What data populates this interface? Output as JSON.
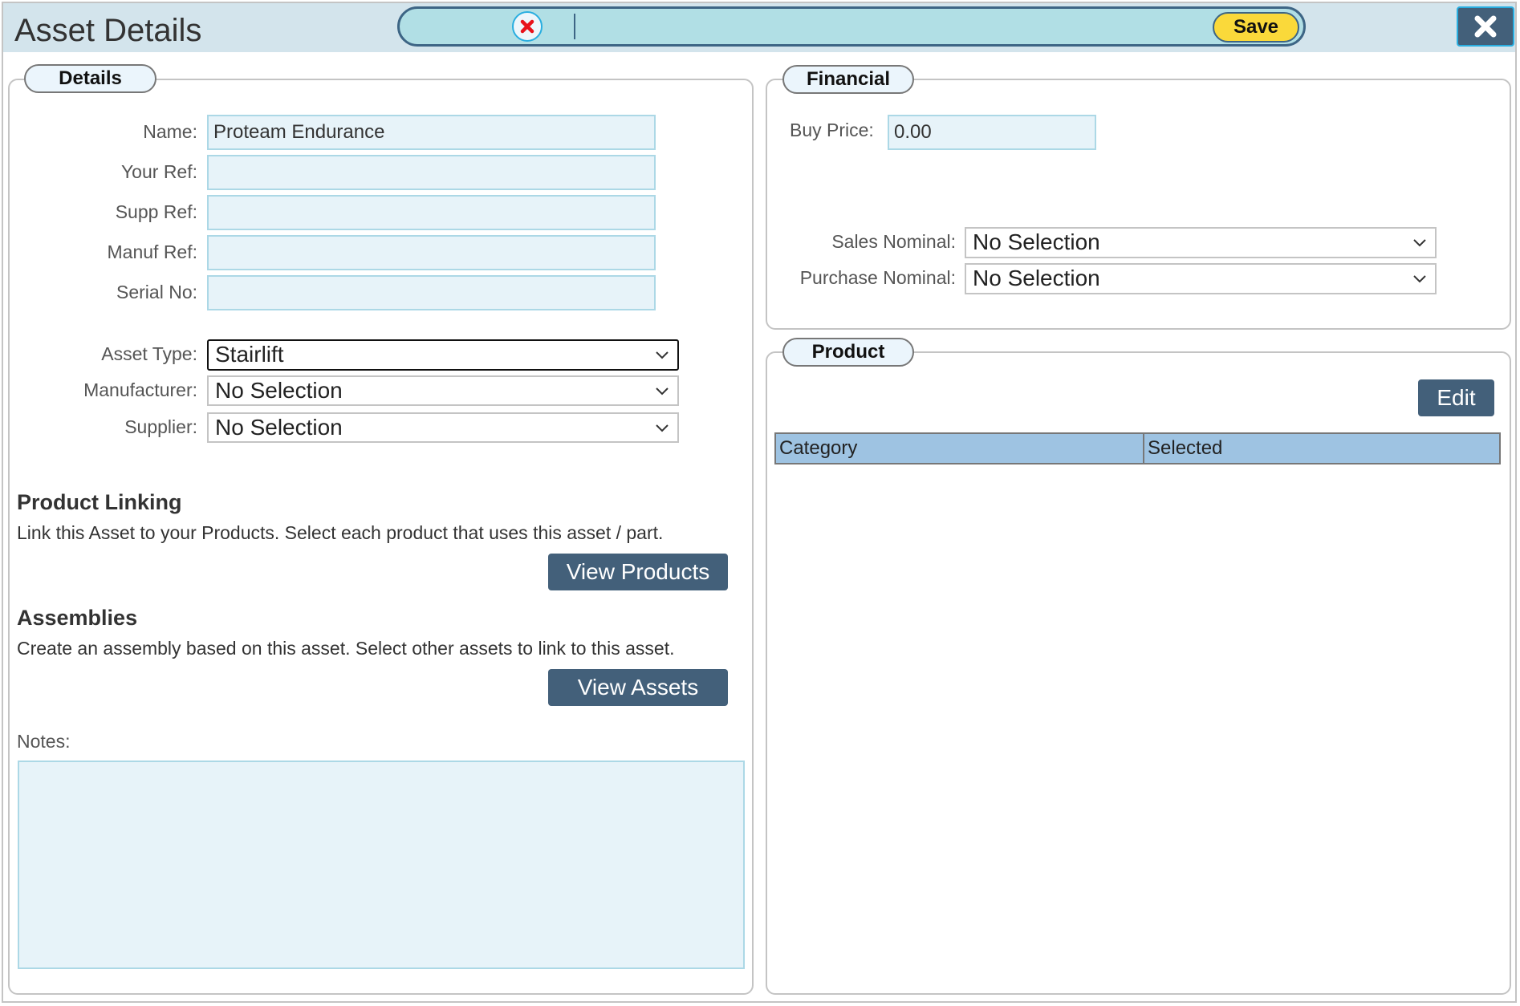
{
  "window": {
    "title": "Asset Details"
  },
  "toolbar": {
    "save_label": "Save",
    "cancel_icon": "red-x-icon",
    "close_icon": "close-x-icon"
  },
  "colors": {
    "header_bg": "#d3e4ec",
    "toolbar_bg": "#b1dfe5",
    "save_bg": "#fad93a",
    "button_bg": "#43607a",
    "input_bg": "#e7f3f9",
    "table_header_bg": "#9ec3e2"
  },
  "details": {
    "legend": "Details",
    "fields": [
      {
        "label": "Name:",
        "value": "Proteam Endurance"
      },
      {
        "label": "Your Ref:",
        "value": ""
      },
      {
        "label": "Supp Ref:",
        "value": ""
      },
      {
        "label": "Manuf Ref:",
        "value": ""
      },
      {
        "label": "Serial No:",
        "value": ""
      }
    ],
    "selects": [
      {
        "label": "Asset Type:",
        "value": "Stairlift"
      },
      {
        "label": "Manufacturer:",
        "value": "No Selection"
      },
      {
        "label": "Supplier:",
        "value": "No Selection"
      }
    ],
    "product_linking": {
      "heading": "Product Linking",
      "description": "Link this Asset to your Products. Select each product that uses this asset / part.",
      "button": "View Products"
    },
    "assemblies": {
      "heading": "Assemblies",
      "description": "Create an assembly based on this asset. Select other assets to link to this asset.",
      "button": "View Assets"
    },
    "notes": {
      "label": "Notes:",
      "value": ""
    }
  },
  "financial": {
    "legend": "Financial",
    "buy_price": {
      "label": "Buy Price:",
      "value": "0.00"
    },
    "sales_nominal": {
      "label": "Sales Nominal:",
      "value": "No Selection"
    },
    "purchase_nominal": {
      "label": "Purchase Nominal:",
      "value": "No Selection"
    }
  },
  "product": {
    "legend": "Product",
    "edit_label": "Edit",
    "table": {
      "columns": [
        "Category",
        "Selected"
      ],
      "rows": []
    }
  }
}
